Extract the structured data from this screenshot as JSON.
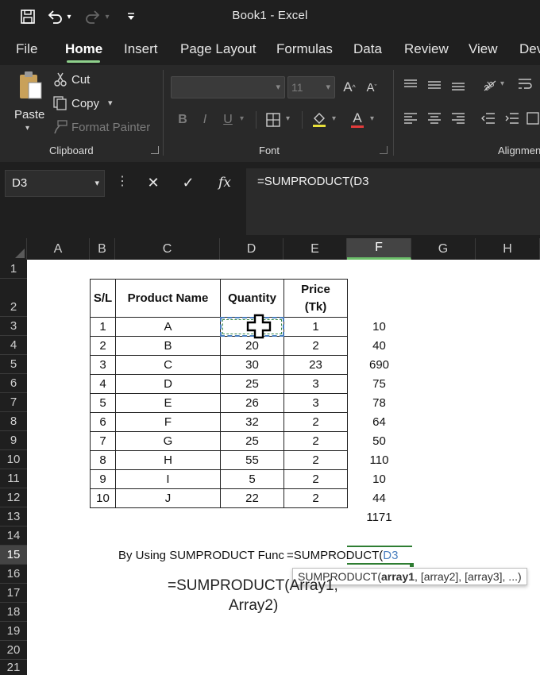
{
  "window": {
    "title": "Book1  -  Excel"
  },
  "tabs": [
    "File",
    "Home",
    "Insert",
    "Page Layout",
    "Formulas",
    "Data",
    "Review",
    "View",
    "Dev"
  ],
  "ribbon": {
    "clipboard": {
      "paste": "Paste",
      "cut": "Cut",
      "copy": "Copy",
      "format_painter": "Format Painter",
      "label": "Clipboard"
    },
    "font": {
      "size": "11",
      "bold": "B",
      "italic": "I",
      "underline": "U",
      "label": "Font"
    },
    "alignment": {
      "label": "Alignmen"
    }
  },
  "formula_bar": {
    "name_box": "D3",
    "cancel": "✕",
    "enter": "✓",
    "fx": "fx",
    "formula": "=SUMPRODUCT(D3"
  },
  "columns": [
    "A",
    "B",
    "C",
    "D",
    "E",
    "F",
    "G",
    "H"
  ],
  "rows": [
    "1",
    "2",
    "3",
    "4",
    "5",
    "6",
    "7",
    "8",
    "9",
    "10",
    "11",
    "12",
    "13",
    "14",
    "15",
    "16",
    "17",
    "18",
    "19",
    "20",
    "21"
  ],
  "table": {
    "headers": {
      "sl": "S/L",
      "name": "Product Name",
      "qty": "Quantity",
      "price_line1": "Price",
      "price_line2": "(Tk)"
    },
    "rows": [
      {
        "sl": "1",
        "name": "A",
        "qty": "",
        "price": "1"
      },
      {
        "sl": "2",
        "name": "B",
        "qty": "20",
        "price": "2"
      },
      {
        "sl": "3",
        "name": "C",
        "qty": "30",
        "price": "23"
      },
      {
        "sl": "4",
        "name": "D",
        "qty": "25",
        "price": "3"
      },
      {
        "sl": "5",
        "name": "E",
        "qty": "26",
        "price": "3"
      },
      {
        "sl": "6",
        "name": "F",
        "qty": "32",
        "price": "2"
      },
      {
        "sl": "7",
        "name": "G",
        "qty": "25",
        "price": "2"
      },
      {
        "sl": "8",
        "name": "H",
        "qty": "55",
        "price": "2"
      },
      {
        "sl": "9",
        "name": "I",
        "qty": "5",
        "price": "2"
      },
      {
        "sl": "10",
        "name": "J",
        "qty": "22",
        "price": "2"
      }
    ],
    "products": [
      "10",
      "40",
      "690",
      "75",
      "78",
      "64",
      "50",
      "110",
      "10",
      "44"
    ],
    "total": "1171"
  },
  "row15": {
    "label": "By Using SUMPRODUCT Func",
    "formula_prefix": "=SUMPRODUCT(",
    "formula_ref": "D3"
  },
  "tooltip": {
    "fn": "SUMPRODUCT(",
    "arg1": "array1",
    "rest": ", [array2], [array3], ...)"
  },
  "note": {
    "line1": "=SUMPRODUCT(Array1,",
    "line2": "Array2)"
  }
}
